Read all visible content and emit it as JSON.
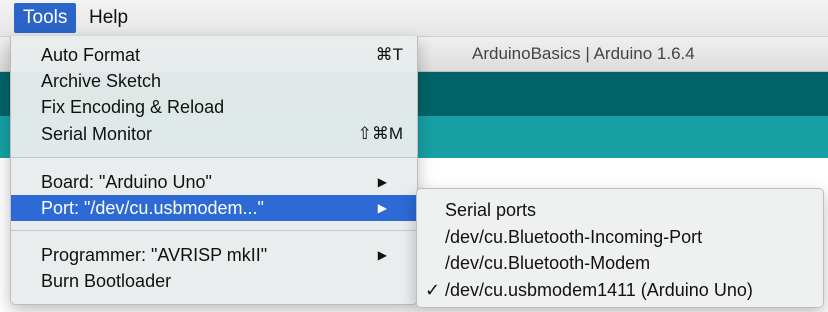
{
  "menubar": {
    "tools": "Tools",
    "help": "Help"
  },
  "window": {
    "title": "ArduinoBasics | Arduino 1.6.4"
  },
  "tools_menu": {
    "items": [
      {
        "label": "Auto Format",
        "shortcut": "⌘T"
      },
      {
        "label": "Archive Sketch"
      },
      {
        "label": "Fix Encoding & Reload"
      },
      {
        "label": "Serial Monitor",
        "shortcut": "⇧⌘M"
      },
      {
        "label": "Board: \"Arduino Uno\""
      },
      {
        "label": "Port: \"/dev/cu.usbmodem...\""
      },
      {
        "label": "Programmer: \"AVRISP mkII\""
      },
      {
        "label": "Burn Bootloader"
      }
    ],
    "submenu_arrow": "▶"
  },
  "port_submenu": {
    "header": "Serial ports",
    "items": [
      {
        "label": "/dev/cu.Bluetooth-Incoming-Port"
      },
      {
        "label": "/dev/cu.Bluetooth-Modem"
      },
      {
        "label": "/dev/cu.usbmodem1411 (Arduino Uno)",
        "check": "✓"
      }
    ]
  },
  "colors": {
    "highlight": "#2d6ad6",
    "ide_toolbar": "#006468",
    "ide_tabs": "#17a1a5"
  }
}
